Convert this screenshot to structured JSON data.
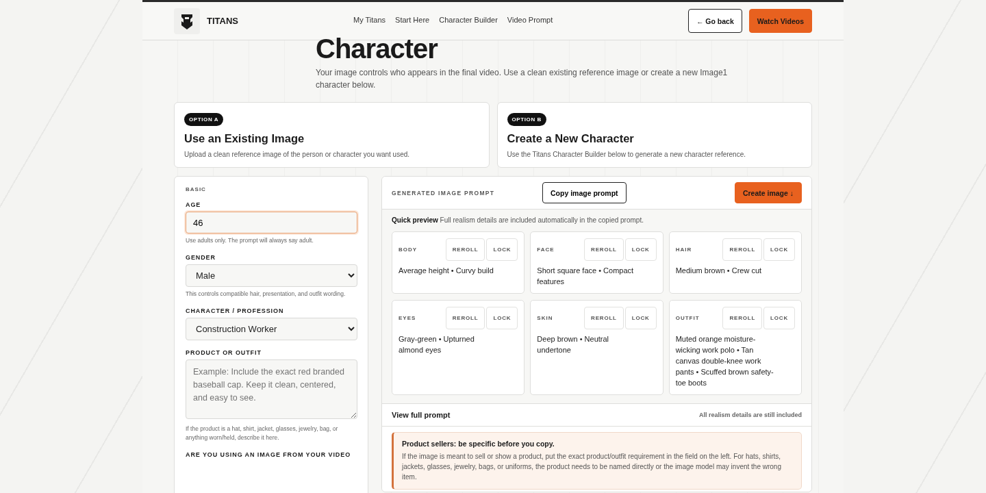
{
  "brand": {
    "name": "TITANS"
  },
  "nav": [
    {
      "label": "My Titans"
    },
    {
      "label": "Start Here"
    },
    {
      "label": "Character Builder"
    },
    {
      "label": "Video Prompt"
    }
  ],
  "header_buttons": [
    {
      "label": "← Go back",
      "kind": "outline"
    },
    {
      "label": "Watch Videos",
      "kind": "primary"
    }
  ],
  "page": {
    "title": "Character",
    "intro": "Your image controls who appears in the final video. Use a clean existing reference image or create a new Image1 character below."
  },
  "options": [
    {
      "badge": "OPTION A",
      "title": "Use an Existing Image",
      "text": "Upload a clean reference image of the person or character you want used."
    },
    {
      "badge": "OPTION B",
      "title": "Create a New Character",
      "text": "Use the Titans Character Builder below to generate a new character reference."
    }
  ],
  "form": {
    "section": "BASIC",
    "fields": [
      {
        "kind": "number",
        "label": "AGE",
        "value": "46",
        "help": "Use adults only. The prompt will always say adult.",
        "focused": true
      },
      {
        "kind": "select",
        "label": "GENDER",
        "value": "Male",
        "help": "This controls compatible hair, presentation, and outfit wording."
      },
      {
        "kind": "select",
        "label": "CHARACTER / PROFESSION",
        "value": "Construction Worker"
      },
      {
        "kind": "textarea",
        "label": "PRODUCT OR OUTFIT",
        "placeholder": "Example: Include the exact red branded baseball cap. Keep it clean, centered, and easy to see.",
        "help": "If the product is a hat, shirt, jacket, glasses, jewelry, bag, or anything worn/held, describe it here."
      },
      {
        "kind": "heading",
        "label": "ARE YOU USING AN IMAGE FROM YOUR VIDEO"
      }
    ]
  },
  "prompt_panel": {
    "title": "GENERATED IMAGE PROMPT",
    "copy_button": "Copy image prompt",
    "create_button": "Create image ↓",
    "preview_intro": "**Quick preview** Full realism details are included automatically in the copied prompt.",
    "traits": [
      {
        "label": "BODY",
        "reroll": "REROLL",
        "lock": "LOCK",
        "value": "Average height • Curvy build"
      },
      {
        "label": "FACE",
        "reroll": "REROLL",
        "lock": "LOCK",
        "value": "Short square face • Compact features"
      },
      {
        "label": "HAIR",
        "reroll": "REROLL",
        "lock": "LOCK",
        "value": "Medium brown • Crew cut"
      },
      {
        "label": "EYES",
        "reroll": "REROLL",
        "lock": "LOCK",
        "value": "Gray-green • Upturned almond eyes"
      },
      {
        "label": "SKIN",
        "reroll": "REROLL",
        "lock": "LOCK",
        "value": "Deep brown • Neutral undertone"
      },
      {
        "label": "OUTFIT",
        "reroll": "REROLL",
        "lock": "LOCK",
        "value": "Muted orange moisture-wicking work polo • Tan canvas double-knee work pants • Scuffed brown safety-toe boots"
      }
    ],
    "full_prompt": {
      "label": "View full prompt",
      "note": "All realism details are still included"
    },
    "callout": {
      "title": "Product sellers: be specific before you copy.",
      "text": "If the image is meant to sell or show a product, put the exact product/outfit requirement in the field on the left. For hats, shirts, jackets, glasses, jewelry, bags, or uniforms, the product needs to be named directly or the image model may invent the wrong item."
    }
  }
}
